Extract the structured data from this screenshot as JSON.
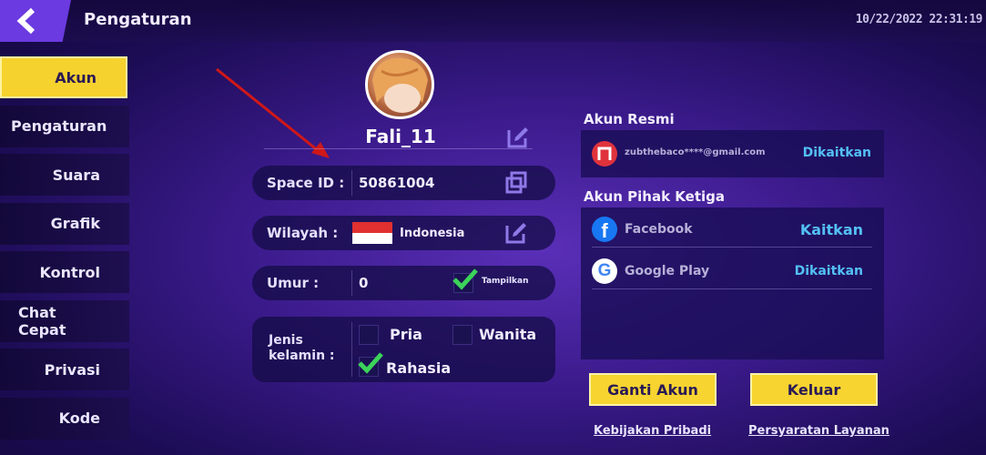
{
  "header": {
    "title": "Pengaturan",
    "datetime": "10/22/2022 22:31:19"
  },
  "sidebar": {
    "items": [
      {
        "label": "Akun",
        "active": true
      },
      {
        "label": "Pengaturan",
        "active": false
      },
      {
        "label": "Suara",
        "active": false
      },
      {
        "label": "Grafik",
        "active": false
      },
      {
        "label": "Kontrol",
        "active": false
      },
      {
        "label": "Chat Cepat",
        "active": false
      },
      {
        "label": "Privasi",
        "active": false
      },
      {
        "label": "Kode",
        "active": false
      }
    ]
  },
  "profile": {
    "username": "Fali_11",
    "space_id_label": "Space ID :",
    "space_id": "50861004",
    "region_label": "Wilayah :",
    "region": "Indonesia",
    "age_label": "Umur :",
    "age": "0",
    "show_label": "Tampilkan",
    "show_checked": true,
    "gender_label": "Jenis kelamin :",
    "gender_options": [
      {
        "label": "Pria",
        "checked": false
      },
      {
        "label": "Wanita",
        "checked": false
      },
      {
        "label": "Rahasia",
        "checked": true
      }
    ]
  },
  "official_account": {
    "title": "Akun Resmi",
    "email": "zubthebaco****@gmail.com",
    "action": "Dikaitkan"
  },
  "third_party": {
    "title": "Akun Pihak Ketiga",
    "accounts": [
      {
        "name": "Facebook",
        "action": "Kaitkan",
        "icon": "facebook-icon"
      },
      {
        "name": "Google Play",
        "action": "Dikaitkan",
        "icon": "google-icon"
      }
    ]
  },
  "buttons": {
    "switch_account": "Ganti Akun",
    "logout": "Keluar"
  },
  "footer": {
    "privacy": "Kebijakan Pribadi",
    "terms": "Persyaratan Layanan"
  },
  "colors": {
    "accent_yellow": "#f7d430",
    "link_blue": "#53c0f5",
    "back_purple": "#6b3ae0"
  }
}
